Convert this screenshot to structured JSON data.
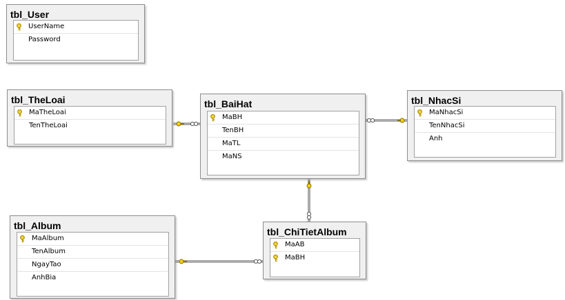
{
  "colors": {
    "key": "#e8c400",
    "line": "#555555",
    "table_bg": "#f0f0f0"
  },
  "tables": {
    "user": {
      "title": "tbl_User",
      "columns": [
        {
          "name": "UserName",
          "pk": true
        },
        {
          "name": "Password",
          "pk": false
        }
      ]
    },
    "theloai": {
      "title": "tbl_TheLoai",
      "columns": [
        {
          "name": "MaTheLoai",
          "pk": true
        },
        {
          "name": "TenTheLoai",
          "pk": false
        }
      ]
    },
    "baihat": {
      "title": "tbl_BaiHat",
      "columns": [
        {
          "name": "MaBH",
          "pk": true
        },
        {
          "name": "TenBH",
          "pk": false
        },
        {
          "name": "MaTL",
          "pk": false
        },
        {
          "name": "MaNS",
          "pk": false
        }
      ]
    },
    "nhacsi": {
      "title": "tbl_NhacSi",
      "columns": [
        {
          "name": "MaNhacSi",
          "pk": true
        },
        {
          "name": "TenNhacSi",
          "pk": false
        },
        {
          "name": "Anh",
          "pk": false
        }
      ]
    },
    "album": {
      "title": "tbl_Album",
      "columns": [
        {
          "name": "MaAlbum",
          "pk": true
        },
        {
          "name": "TenAlbum",
          "pk": false
        },
        {
          "name": "NgayTao",
          "pk": false
        },
        {
          "name": "AnhBia",
          "pk": false
        }
      ]
    },
    "chitietalbum": {
      "title": "tbl_ChiTietAlbum",
      "columns": [
        {
          "name": "MaAB",
          "pk": true
        },
        {
          "name": "MaBH",
          "pk": true
        }
      ]
    }
  },
  "relationships": [
    {
      "from": "tbl_TheLoai",
      "to": "tbl_BaiHat"
    },
    {
      "from": "tbl_NhacSi",
      "to": "tbl_BaiHat"
    },
    {
      "from": "tbl_BaiHat",
      "to": "tbl_ChiTietAlbum"
    },
    {
      "from": "tbl_Album",
      "to": "tbl_ChiTietAlbum"
    }
  ]
}
